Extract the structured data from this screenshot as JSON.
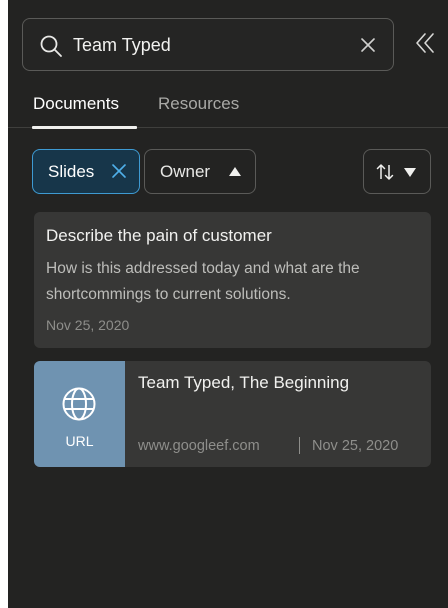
{
  "search": {
    "value": "Team Typed",
    "placeholder": ""
  },
  "tabs": [
    {
      "label": "Documents",
      "active": true
    },
    {
      "label": "Resources",
      "active": false
    }
  ],
  "filters": {
    "slides_label": "Slides",
    "owner_label": "Owner"
  },
  "cards": {
    "note": {
      "title": "Describe the pain of customer",
      "body": "How is this addressed today and what are the shortcommings to current solutions.",
      "date": "Nov 25, 2020"
    },
    "url": {
      "thumb_label": "URL",
      "title": "Team Typed, The Beginning",
      "domain": "www.googleef.com",
      "date": "Nov 25, 2020"
    }
  },
  "icons": {
    "search": "search-icon",
    "clear": "close-icon",
    "collapse": "double-chevron-left-icon",
    "slides_remove": "close-icon",
    "owner_toggle": "triangle-up-icon",
    "sort": "sort-arrows-icon",
    "sort_menu": "triangle-down-icon",
    "url_thumb": "globe-icon"
  },
  "colors": {
    "panel_bg": "#232322",
    "card_bg": "#373736",
    "accent": "#3e9ad2",
    "url_thumb_bg": "#6f93b1"
  }
}
